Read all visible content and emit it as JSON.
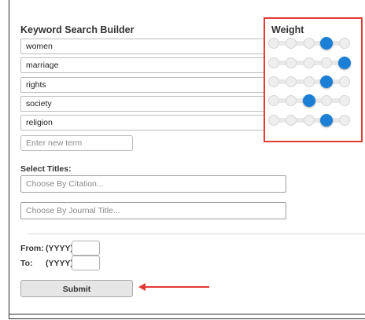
{
  "builder": {
    "title": "Keyword Search Builder",
    "terms": [
      {
        "value": "women",
        "weight_level": 4
      },
      {
        "value": "marriage",
        "weight_level": 5
      },
      {
        "value": "rights",
        "weight_level": 4
      },
      {
        "value": "society",
        "weight_level": 3
      },
      {
        "value": "religion",
        "weight_level": 4
      }
    ],
    "new_term_placeholder": "Enter new term"
  },
  "weight": {
    "title": "Weight",
    "levels": 5,
    "thumb_color": "#1c7fd6",
    "highlight_color": "#e53935"
  },
  "titles": {
    "label": "Select Titles:",
    "citation_placeholder": "Choose By Citation...",
    "journal_placeholder": "Choose By Journal Title..."
  },
  "date_range": {
    "from_label": "From:",
    "to_label": "To:",
    "format_hint": "(YYYY)",
    "from_value": "",
    "to_value": ""
  },
  "actions": {
    "submit_label": "Submit"
  }
}
